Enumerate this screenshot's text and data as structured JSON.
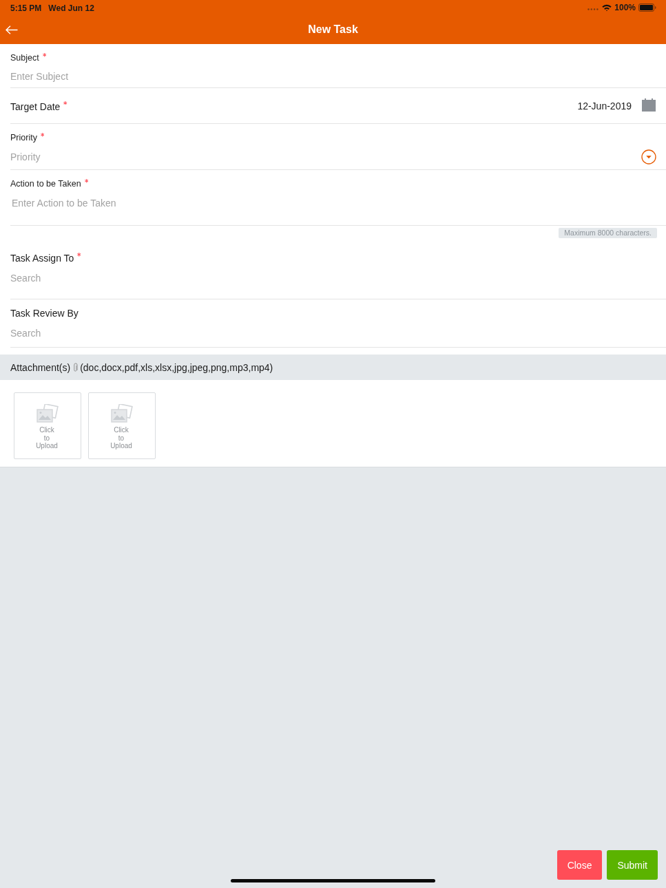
{
  "status_bar": {
    "time": "5:15 PM",
    "date": "Wed Jun 12",
    "battery": "100%"
  },
  "header": {
    "title": "New Task"
  },
  "form": {
    "fields": [
      {
        "kind": "text",
        "label": "Subject",
        "required": true,
        "placeholder": "Enter Subject"
      },
      {
        "kind": "date",
        "label": "Target Date",
        "required": true,
        "value": "12-Jun-2019"
      },
      {
        "kind": "select",
        "label": "Priority",
        "required": true,
        "placeholder": "Priority"
      },
      {
        "kind": "textarea",
        "label": "Action to be Taken",
        "required": true,
        "placeholder": "Enter Action to be Taken",
        "hint": "Maximum 8000 characters."
      },
      {
        "kind": "search",
        "label": "Task Assign To",
        "required": true,
        "placeholder": "Search"
      },
      {
        "kind": "search",
        "label": "Task Review By",
        "required": false,
        "placeholder": "Search"
      }
    ]
  },
  "attachments": {
    "label": "Attachment(s)",
    "formats": "(doc,docx,pdf,xls,xlsx,jpg,jpeg,png,mp3,mp4)",
    "slots": [
      {
        "text": "Click to Upload"
      },
      {
        "text": "Click to Upload"
      }
    ]
  },
  "buttons": [
    {
      "kind": "close",
      "label": "Close"
    },
    {
      "kind": "submit",
      "label": "Submit"
    }
  ]
}
